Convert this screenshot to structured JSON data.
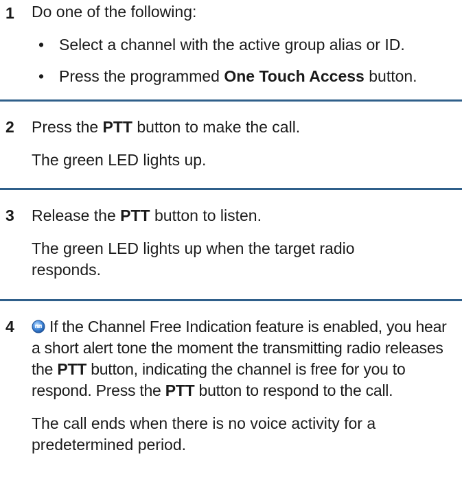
{
  "steps": [
    {
      "number": "1",
      "text": "Do one of the following:",
      "bullets": [
        {
          "mark": "•",
          "text": "Select a channel with the active group alias or ID."
        },
        {
          "mark": "•",
          "pre": "Press the programmed ",
          "bold": "One Touch Access",
          "post": " button."
        }
      ]
    },
    {
      "number": "2",
      "pre": "Press the ",
      "bold": "PTT",
      "post": " button to make the call.",
      "result": "The green LED lights up."
    },
    {
      "number": "3",
      "pre": "Release the ",
      "bold": "PTT",
      "post": " button to listen.",
      "result": "The green LED lights up when the target radio responds."
    },
    {
      "number": "4",
      "icon": "feature-indicator-icon",
      "t1": "If the Channel Free Indication feature is enabled, you hear a short alert tone the moment the transmitting radio releases the ",
      "b1": "PTT",
      "t2": " button, indicating the channel is free for you to respond. Press the ",
      "b2": "PTT",
      "t3": " button to respond to the call.",
      "result": "The call ends when there is no voice activity for a predetermined period."
    }
  ],
  "colors": {
    "rule": "#2f5f8a",
    "icon": "#2d6fc0"
  }
}
